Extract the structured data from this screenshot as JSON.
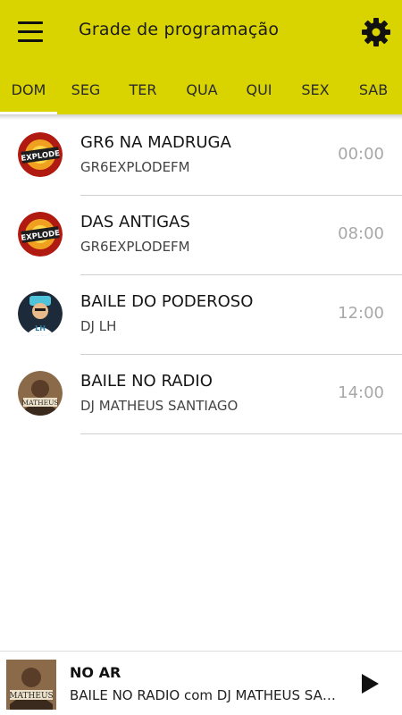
{
  "header": {
    "title": "Grade de programação",
    "menu_icon": "hamburger-menu-icon",
    "settings_icon": "gear-icon",
    "background_color": "#d9d400"
  },
  "tabs": [
    {
      "label": "DOM",
      "active": true
    },
    {
      "label": "SEG",
      "active": false
    },
    {
      "label": "TER",
      "active": false
    },
    {
      "label": "QUA",
      "active": false
    },
    {
      "label": "QUI",
      "active": false
    },
    {
      "label": "SEX",
      "active": false
    },
    {
      "label": "SAB",
      "active": false
    }
  ],
  "schedule": [
    {
      "name": "GR6 NA MADRUGA",
      "host": "GR6EXPLODEFM",
      "time": "00:00",
      "avatar_logo": "EXPLODE"
    },
    {
      "name": "DAS ANTIGAS",
      "host": "GR6EXPLODEFM",
      "time": "08:00",
      "avatar_logo": "EXPLODE"
    },
    {
      "name": "BAILE DO PODEROSO",
      "host": "DJ LH",
      "time": "12:00",
      "avatar_logo": "LH"
    },
    {
      "name": "BAILE NO RADIO",
      "host": "DJ MATHEUS SANTIAGO",
      "time": "14:00",
      "avatar_logo": "MATHEUS"
    }
  ],
  "player": {
    "label": "NO AR",
    "track": "BAILE NO RADIO com DJ MATHEUS SANTIAGO",
    "thumb_logo": "MATHEUS",
    "play_icon": "play-icon"
  }
}
